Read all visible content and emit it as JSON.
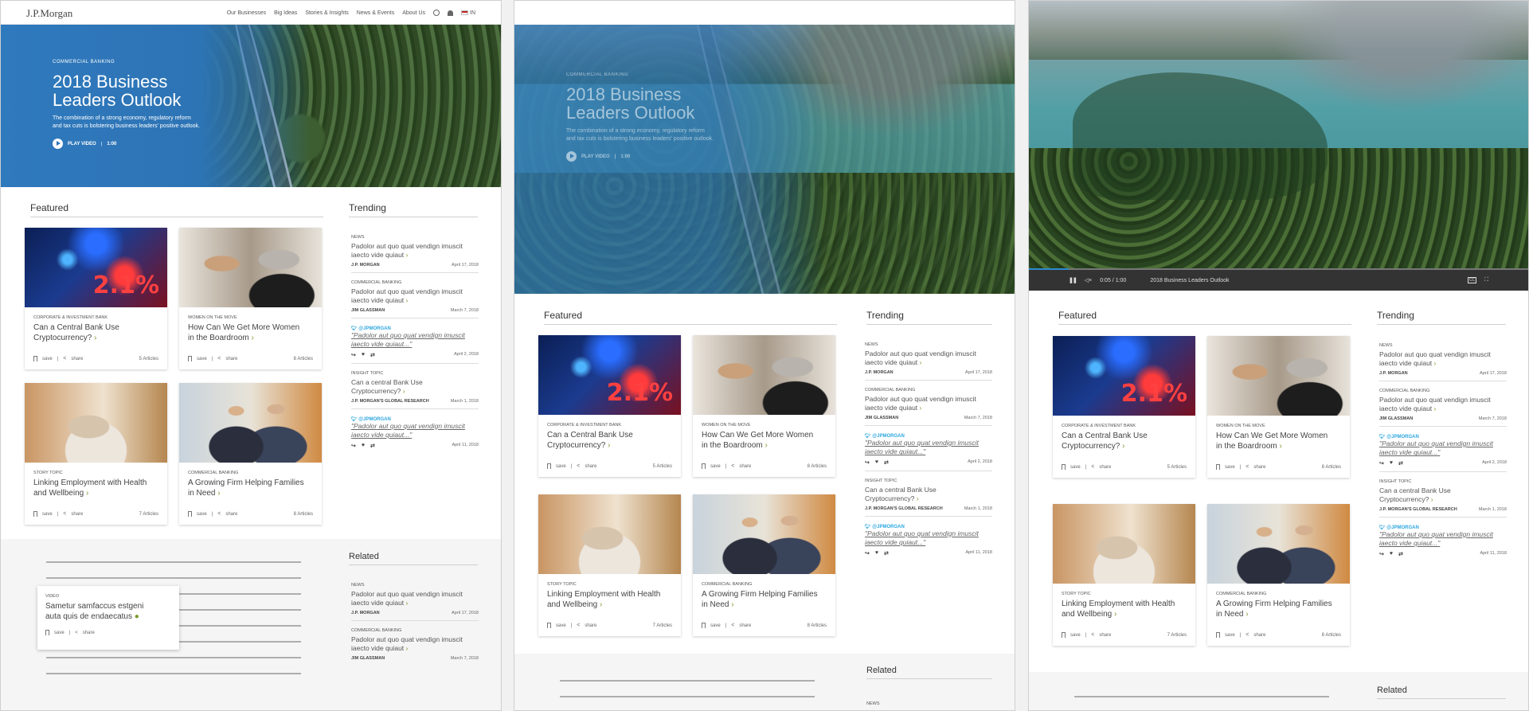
{
  "header": {
    "logo": "J.P.Morgan",
    "nav": [
      "Our Businesses",
      "Big Ideas",
      "Stories & Insights",
      "News & Events",
      "About Us"
    ],
    "region": "IN"
  },
  "hero": {
    "eyebrow": "COMMERCIAL BANKING",
    "title_line1": "2018 Business",
    "title_line2": "Leaders Outlook",
    "desc_line1": "The combination of a strong economy, regulatory reform",
    "desc_line2": "and tax cuts is bolstering business leaders' positive outlook.",
    "play_label": "PLAY VIDEO",
    "duration": "1:00"
  },
  "featured": {
    "heading": "Featured",
    "save": "save",
    "share": "share",
    "cards": [
      {
        "category": "CORPORATE & INVESTMENT BANK",
        "title_line1": "Can a Central Bank Use",
        "title_line2": "Cryptocurrency?",
        "count": "5 Articles",
        "image": "market-ticker",
        "overlay": "2.1%"
      },
      {
        "category": "WOMEN ON THE MOVE",
        "title_line1": "How Can We Get More Women",
        "title_line2": "in the Boardroom",
        "count": "8 Articles",
        "image": "business-people"
      },
      {
        "category": "STORY TOPIC",
        "title_line1": "Linking Employment with Health",
        "title_line2": "and Wellbeing",
        "count": "7 Articles",
        "image": "meditation"
      },
      {
        "category": "COMMERCIAL BANKING",
        "title_line1": "A Growing Firm Helping Families",
        "title_line2": "in Need",
        "count": "8 Articles",
        "image": "two-men-warehouse"
      }
    ]
  },
  "trending": {
    "heading": "Trending",
    "items": [
      {
        "label": "NEWS",
        "line1": "Padolor aut quo quat vendign imuscit",
        "line2": "iaecto vide quiaut",
        "source": "J.P. MORGAN",
        "date": "April 17, 2018"
      },
      {
        "label": "COMMERCIAL BANKING",
        "line1": "Padolor aut quo quat vendign imuscit",
        "line2": "iaecto vide quiaut",
        "source": "JIM GLASSMAN",
        "date": "March 7, 2018"
      },
      {
        "handle": "@JPMORGAN",
        "quote1": "\"Padolor aut quo quat vendign imuscit",
        "quote2": "iaecto vide quiaut...\"",
        "date": "April 2, 2018"
      },
      {
        "label": "INSIGHT TOPIC",
        "line1": "Can a central Bank Use",
        "line2": "Cryptocurrency?",
        "source": "J.P. MORGAN'S GLOBAL RESEARCH",
        "date": "March 1, 2018"
      },
      {
        "handle": "@JPMORGAN",
        "quote1": "\"Padolor aut quo quat vendign imuscit",
        "quote2": "iaecto vide quiaut...\"",
        "date": "April 11, 2018"
      }
    ]
  },
  "related": {
    "heading": "Related",
    "video_card": {
      "label": "VIDEO",
      "line1": "Sametur samfaccus estgeni",
      "line2": "auta quis de endaecatus",
      "save": "save",
      "share": "share"
    },
    "items": [
      {
        "label": "NEWS",
        "line1": "Padolor aut quo quat vendign imuscit",
        "line2": "iaecto vide quiaut",
        "source": "J.P. MORGAN",
        "date": "April 17, 2018"
      },
      {
        "label": "COMMERCIAL BANKING",
        "line1": "Padolor aut quo quat vendign imuscit",
        "line2": "iaecto vide quiaut",
        "source": "JIM GLASSMAN",
        "date": "March 7, 2018"
      }
    ],
    "news_label": "NEWS"
  },
  "video_player": {
    "current": "0:05",
    "total": "1:00",
    "title": "2018 Business Leaders Outlook",
    "progress": 0.08
  },
  "colors": {
    "brand_blue": "#2d74b5",
    "accent_green": "#7a9b2e",
    "twitter": "#2da7e0"
  }
}
